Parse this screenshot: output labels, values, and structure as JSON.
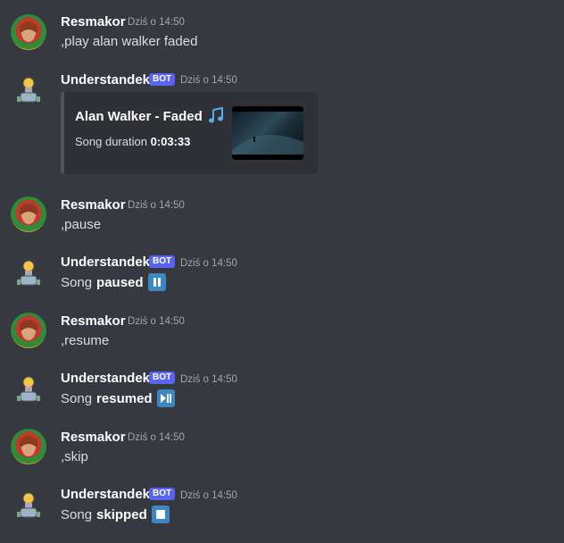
{
  "messages": [
    {
      "author": "Resmakor",
      "timestamp": "Dziś o 14:50",
      "text": ",play alan walker faded"
    },
    {
      "author": "Understandek",
      "badge": "BOT",
      "timestamp": "Dziś o 14:50",
      "embed": {
        "title": "Alan Walker - Faded",
        "title_icon": "musical-note-icon",
        "desc_label": "Song duration",
        "desc_value": "0:03:33"
      }
    },
    {
      "author": "Resmakor",
      "timestamp": "Dziś o 14:50",
      "text": ",pause"
    },
    {
      "author": "Understandek",
      "badge": "BOT",
      "timestamp": "Dziś o 14:50",
      "text_prefix": "Song",
      "text_bold": "paused",
      "emoji": "pause-button-icon"
    },
    {
      "author": "Resmakor",
      "timestamp": "Dziś o 14:50",
      "text": ",resume"
    },
    {
      "author": "Understandek",
      "badge": "BOT",
      "timestamp": "Dziś o 14:50",
      "text_prefix": "Song",
      "text_bold": "resumed",
      "emoji": "play-pause-button-icon"
    },
    {
      "author": "Resmakor",
      "timestamp": "Dziś o 14:50",
      "text": ",skip"
    },
    {
      "author": "Understandek",
      "badge": "BOT",
      "timestamp": "Dziś o 14:50",
      "text_prefix": "Song",
      "text_bold": "skipped",
      "emoji": "stop-button-icon"
    }
  ],
  "colors": {
    "background": "#36393f",
    "embed_background": "#2f3136",
    "bot_badge": "#5865f2",
    "emoji_blue": "#3b88c3"
  }
}
